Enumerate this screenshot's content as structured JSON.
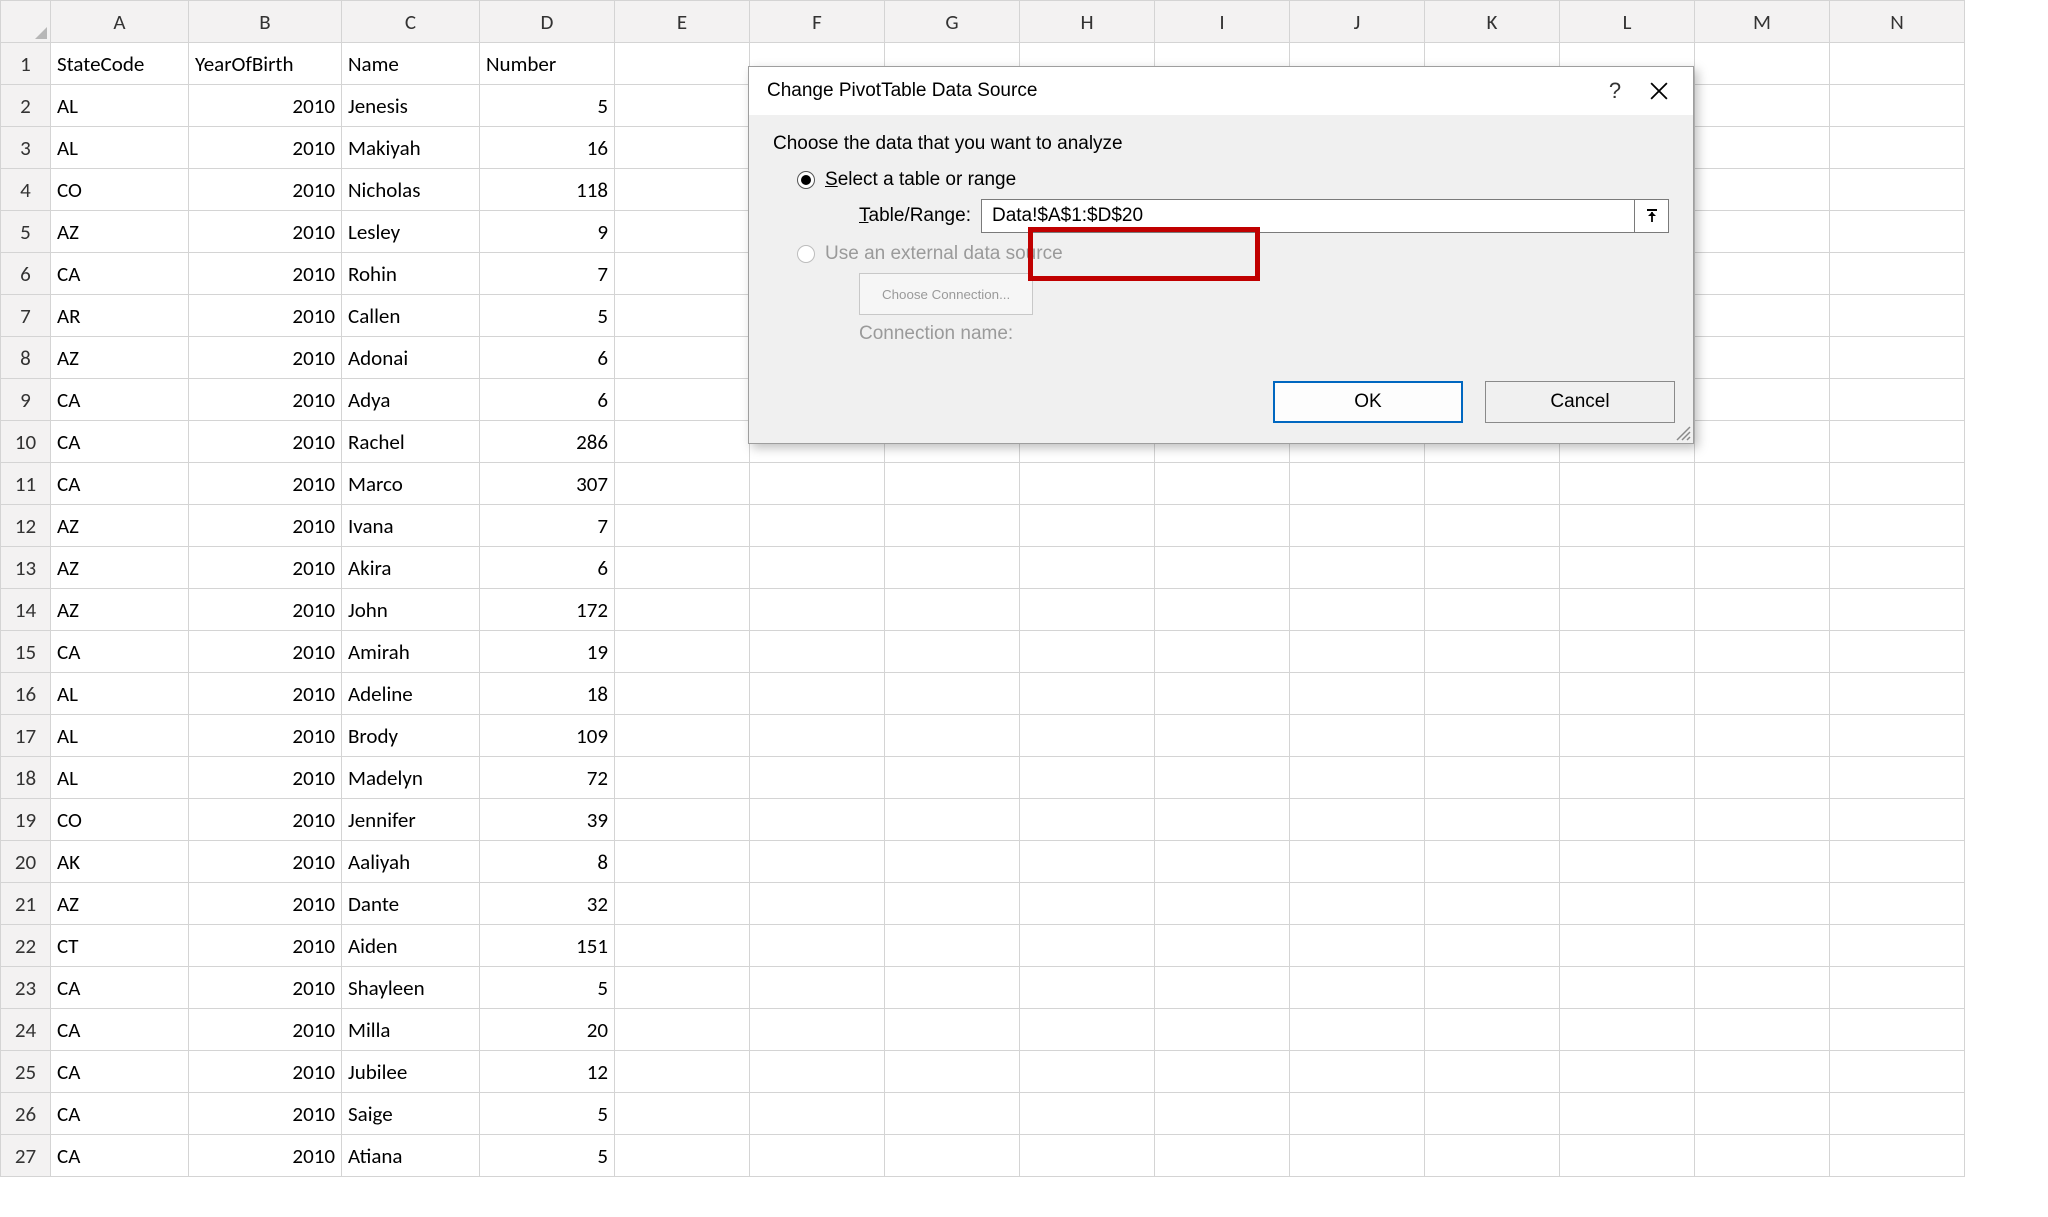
{
  "columns": [
    "A",
    "B",
    "C",
    "D",
    "E",
    "F",
    "G",
    "H",
    "I",
    "J",
    "K",
    "L",
    "M",
    "N"
  ],
  "headers": {
    "A": "StateCode",
    "B": "YearOfBirth",
    "C": "Name",
    "D": "Number"
  },
  "rows": [
    {
      "A": "AL",
      "B": "2010",
      "C": "Jenesis",
      "D": "5"
    },
    {
      "A": "AL",
      "B": "2010",
      "C": "Makiyah",
      "D": "16"
    },
    {
      "A": "CO",
      "B": "2010",
      "C": "Nicholas",
      "D": "118"
    },
    {
      "A": "AZ",
      "B": "2010",
      "C": "Lesley",
      "D": "9"
    },
    {
      "A": "CA",
      "B": "2010",
      "C": "Rohin",
      "D": "7"
    },
    {
      "A": "AR",
      "B": "2010",
      "C": "Callen",
      "D": "5"
    },
    {
      "A": "AZ",
      "B": "2010",
      "C": "Adonai",
      "D": "6"
    },
    {
      "A": "CA",
      "B": "2010",
      "C": "Adya",
      "D": "6"
    },
    {
      "A": "CA",
      "B": "2010",
      "C": "Rachel",
      "D": "286"
    },
    {
      "A": "CA",
      "B": "2010",
      "C": "Marco",
      "D": "307"
    },
    {
      "A": "AZ",
      "B": "2010",
      "C": "Ivana",
      "D": "7"
    },
    {
      "A": "AZ",
      "B": "2010",
      "C": "Akira",
      "D": "6"
    },
    {
      "A": "AZ",
      "B": "2010",
      "C": "John",
      "D": "172"
    },
    {
      "A": "CA",
      "B": "2010",
      "C": "Amirah",
      "D": "19"
    },
    {
      "A": "AL",
      "B": "2010",
      "C": "Adeline",
      "D": "18"
    },
    {
      "A": "AL",
      "B": "2010",
      "C": "Brody",
      "D": "109"
    },
    {
      "A": "AL",
      "B": "2010",
      "C": "Madelyn",
      "D": "72"
    },
    {
      "A": "CO",
      "B": "2010",
      "C": "Jennifer",
      "D": "39"
    },
    {
      "A": "AK",
      "B": "2010",
      "C": "Aaliyah",
      "D": "8"
    },
    {
      "A": "AZ",
      "B": "2010",
      "C": "Dante",
      "D": "32"
    },
    {
      "A": "CT",
      "B": "2010",
      "C": "Aiden",
      "D": "151"
    },
    {
      "A": "CA",
      "B": "2010",
      "C": "Shayleen",
      "D": "5"
    },
    {
      "A": "CA",
      "B": "2010",
      "C": "Milla",
      "D": "20"
    },
    {
      "A": "CA",
      "B": "2010",
      "C": "Jubilee",
      "D": "12"
    },
    {
      "A": "CA",
      "B": "2010",
      "C": "Saige",
      "D": "5"
    },
    {
      "A": "CA",
      "B": "2010",
      "C": "Atiana",
      "D": "5"
    }
  ],
  "dialog": {
    "title": "Change PivotTable Data Source",
    "help": "?",
    "instruction": "Choose the data that you want to analyze",
    "opt_select_pre": "S",
    "opt_select_post": "elect a table or range",
    "range_label_pre": "T",
    "range_label_post": "able/Range:",
    "range_value": "Data!$A$1:$D$20",
    "opt_external": "Use an external data source",
    "choose_connection": "Choose Connection...",
    "connection_name": "Connection name:",
    "ok": "OK",
    "cancel": "Cancel"
  }
}
